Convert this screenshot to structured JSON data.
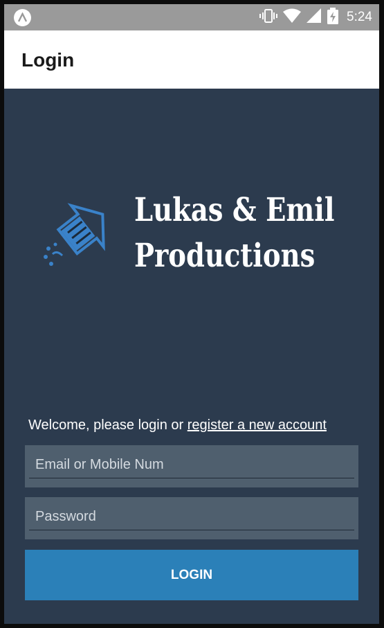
{
  "status_bar": {
    "time": "5:24",
    "icons": [
      "app-launcher-icon",
      "vibrate-icon",
      "wifi-icon",
      "cell-signal-icon",
      "battery-charging-icon"
    ]
  },
  "app_bar": {
    "title": "Login"
  },
  "logo": {
    "line1": "Lukas & Emil",
    "line2": "Productions",
    "icon": "firework-rocket-icon"
  },
  "welcome": {
    "prefix": "Welcome, please login or ",
    "link": "register a new account"
  },
  "form": {
    "email": {
      "value": "",
      "placeholder": "Email or Mobile Num"
    },
    "password": {
      "value": "",
      "placeholder": "Password"
    },
    "login_label": "LOGIN"
  },
  "colors": {
    "background": "#2c3b4e",
    "field": "#4f5f6e",
    "button": "#2b80b8",
    "logo_icon": "#3a82c9"
  }
}
